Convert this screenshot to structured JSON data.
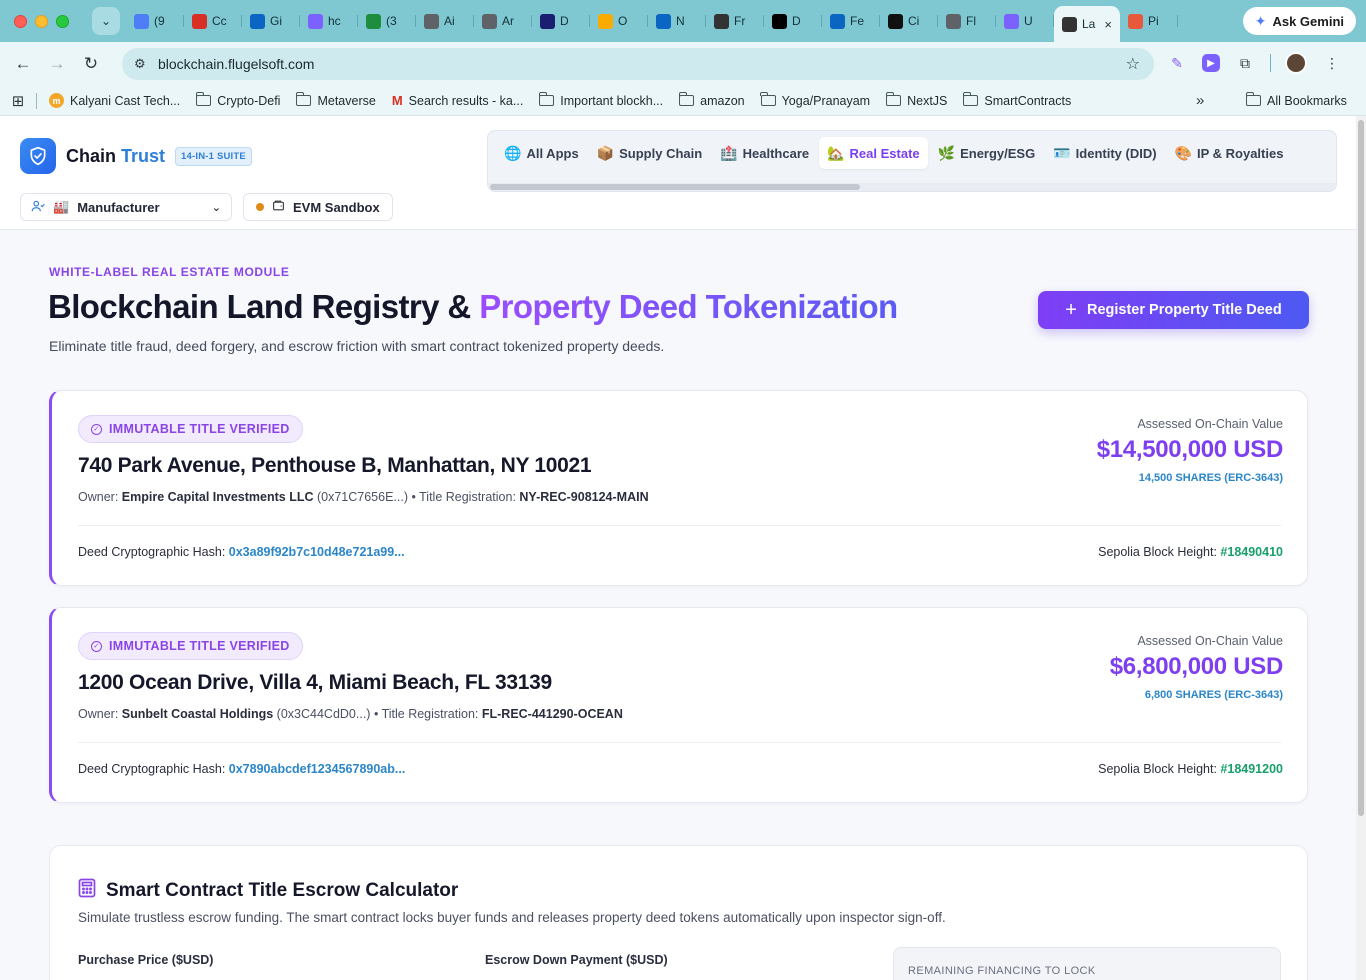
{
  "browser": {
    "tabs": [
      {
        "label": "(9",
        "icon": "mail-icon",
        "color": "#4f7cf7"
      },
      {
        "label": "Cc",
        "icon": "gmail-icon",
        "color": "#d93025"
      },
      {
        "label": "Gi",
        "icon": "linkedin-icon",
        "color": "#0a66c2"
      },
      {
        "label": "hc",
        "icon": "gemini-icon",
        "color": "#7b61ff"
      },
      {
        "label": "(3",
        "icon": "calendar-icon",
        "color": "#1e8e3e"
      },
      {
        "label": "Ai",
        "icon": "globe-icon",
        "color": "#5f6368"
      },
      {
        "label": "Ar",
        "icon": "globe-icon",
        "color": "#5f6368"
      },
      {
        "label": "D",
        "icon": "doc-icon",
        "color": "#1a1f71"
      },
      {
        "label": "O",
        "icon": "analytics-icon",
        "color": "#f9ab00"
      },
      {
        "label": "N",
        "icon": "linkedin-icon",
        "color": "#0a66c2"
      },
      {
        "label": "Fr",
        "icon": "md-icon",
        "color": "#333333"
      },
      {
        "label": "D",
        "icon": "medium-icon",
        "color": "#000000"
      },
      {
        "label": "Fe",
        "icon": "linkedin-icon",
        "color": "#0a66c2"
      },
      {
        "label": "Ci",
        "icon": "openai-icon",
        "color": "#111111"
      },
      {
        "label": "Fl",
        "icon": "globe-icon",
        "color": "#5f6368"
      },
      {
        "label": "U",
        "icon": "gemini-icon",
        "color": "#7b61ff"
      },
      {
        "label": "La",
        "icon": "page-icon",
        "color": "#333333",
        "active": true
      },
      {
        "label": "Pi",
        "icon": "p-icon",
        "color": "#e8593c"
      }
    ],
    "ask_gemini": "Ask Gemini",
    "url": "blockchain.flugelsoft.com",
    "bookmarks": [
      {
        "label": "Kalyani Cast Tech...",
        "type": "site"
      },
      {
        "label": "Crypto-Defi",
        "type": "folder"
      },
      {
        "label": "Metaverse",
        "type": "folder"
      },
      {
        "label": "Search results - ka...",
        "type": "gmail"
      },
      {
        "label": "Important blockh...",
        "type": "folder"
      },
      {
        "label": "amazon",
        "type": "folder"
      },
      {
        "label": "Yoga/Pranayam",
        "type": "folder"
      },
      {
        "label": "NextJS",
        "type": "folder"
      },
      {
        "label": "SmartContracts",
        "type": "folder"
      }
    ],
    "more_bookmarks": "»",
    "all_bookmarks": "All Bookmarks"
  },
  "app": {
    "brand_chain": "Chain",
    "brand_trust": "Trust",
    "suite_badge": "14-IN-1 SUITE",
    "nav_tabs": [
      {
        "emoji": "🌐",
        "label": "All Apps"
      },
      {
        "emoji": "📦",
        "label": "Supply Chain"
      },
      {
        "emoji": "🏥",
        "label": "Healthcare"
      },
      {
        "emoji": "🏡",
        "label": "Real Estate",
        "active": true
      },
      {
        "emoji": "🌿",
        "label": "Energy/ESG"
      },
      {
        "emoji": "🪪",
        "label": "Identity (DID)"
      },
      {
        "emoji": "🎨",
        "label": "IP & Royalties"
      }
    ],
    "role_emoji": "🏭",
    "role": "Manufacturer",
    "network": "EVM Sandbox"
  },
  "hero": {
    "eyebrow": "WHITE-LABEL REAL ESTATE MODULE",
    "title_plain": "Blockchain Land Registry &",
    "title_gradient": "Property Deed Tokenization",
    "subtitle": "Eliminate title fraud, deed forgery, and escrow friction with smart contract tokenized property deeds.",
    "cta": "Register Property Title Deed"
  },
  "deeds": [
    {
      "badge": "IMMUTABLE TITLE VERIFIED",
      "address": "740 Park Avenue, Penthouse B, Manhattan, NY 10021",
      "owner_label": "Owner:",
      "owner": "Empire Capital Investments LLC",
      "owner_wallet": "(0x71C7656E...)",
      "title_reg_label": "• Title Registration:",
      "title_reg": "NY-REC-908124-MAIN",
      "hash_label": "Deed Cryptographic Hash:",
      "hash": "0x3a89f92b7c10d48e721a99...",
      "block_label": "Sepolia Block Height:",
      "block": "#18490410",
      "value_label": "Assessed On-Chain Value",
      "value": "$14,500,000 USD",
      "shares": "14,500 SHARES (ERC-3643)"
    },
    {
      "badge": "IMMUTABLE TITLE VERIFIED",
      "address": "1200 Ocean Drive, Villa 4, Miami Beach, FL 33139",
      "owner_label": "Owner:",
      "owner": "Sunbelt Coastal Holdings",
      "owner_wallet": "(0x3C44CdD0...)",
      "title_reg_label": "• Title Registration:",
      "title_reg": "FL-REC-441290-OCEAN",
      "hash_label": "Deed Cryptographic Hash:",
      "hash": "0x7890abcdef1234567890ab...",
      "block_label": "Sepolia Block Height:",
      "block": "#18491200",
      "value_label": "Assessed On-Chain Value",
      "value": "$6,800,000 USD",
      "shares": "6,800 SHARES (ERC-3643)"
    }
  ],
  "calculator": {
    "title": "Smart Contract Title Escrow Calculator",
    "description": "Simulate trustless escrow funding. The smart contract locks buyer funds and releases property deed tokens automatically upon inspector sign-off.",
    "purchase_price_label": "Purchase Price ($USD)",
    "down_payment_label": "Escrow Down Payment ($USD)",
    "remaining_label": "REMAINING FINANCING TO LOCK"
  }
}
